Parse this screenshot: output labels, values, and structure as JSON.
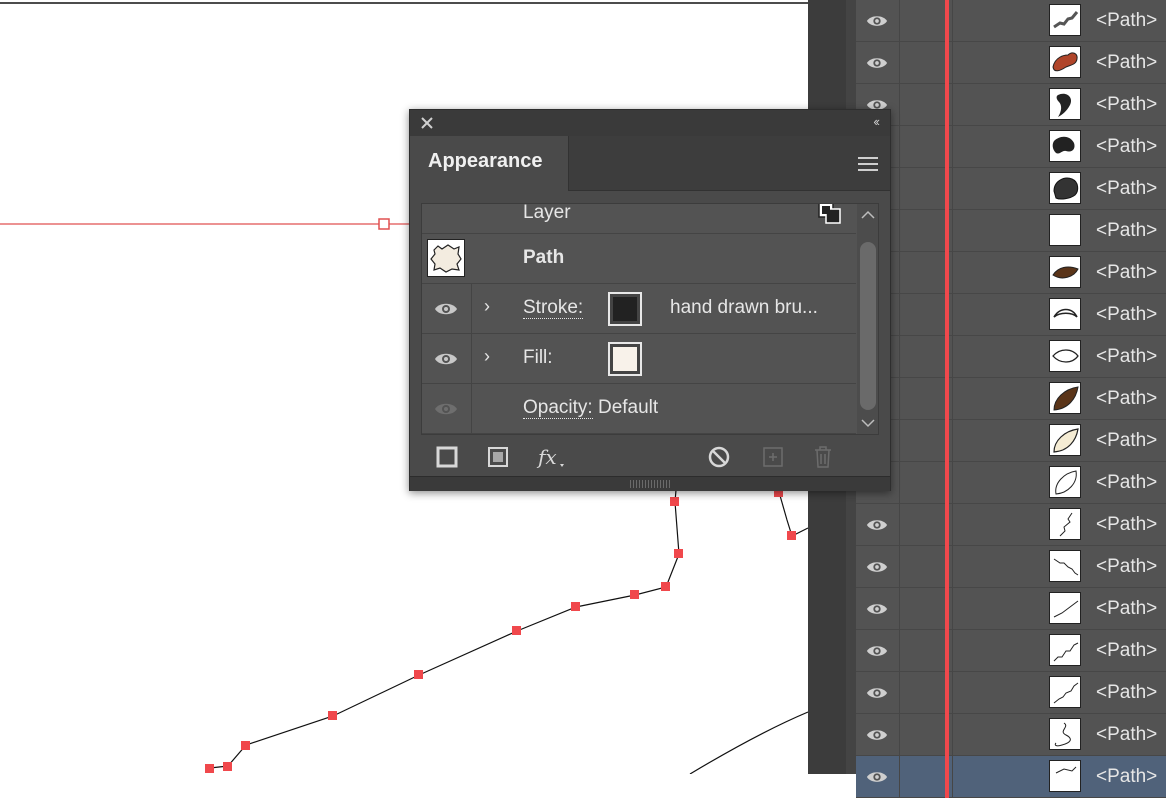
{
  "appearance_panel": {
    "tab_label": "Appearance",
    "layer_label": "Layer",
    "path_label": "Path",
    "stroke_label": "Stroke:",
    "stroke_value": "hand drawn bru...",
    "fill_label": "Fill:",
    "opacity_label": "Opacity:",
    "opacity_value": "Default",
    "stroke_color": "#222222",
    "fill_color": "#f8f2ea",
    "footer_icons": [
      "add-stroke-icon",
      "add-fill-icon",
      "fx-icon",
      "clear-appearance-icon",
      "duplicate-item-icon",
      "delete-item-icon"
    ]
  },
  "layers_panel": {
    "rows": [
      {
        "name": "<Path>",
        "thumb": "brush-stroke"
      },
      {
        "name": "<Path>",
        "thumb": "orange-leaf"
      },
      {
        "name": "<Path>",
        "thumb": "dark-drop"
      },
      {
        "name": "<Path>",
        "thumb": "dark-drop-2"
      },
      {
        "name": "<Path>",
        "thumb": "dark-blob"
      },
      {
        "name": "<Path>",
        "thumb": "blank"
      },
      {
        "name": "<Path>",
        "thumb": "brown-leaf"
      },
      {
        "name": "<Path>",
        "thumb": "outline-arc"
      },
      {
        "name": "<Path>",
        "thumb": "outline-leaf"
      },
      {
        "name": "<Path>",
        "thumb": "brown-teardrop"
      },
      {
        "name": "<Path>",
        "thumb": "cream-teardrop"
      },
      {
        "name": "<Path>",
        "thumb": "thin-leaf"
      },
      {
        "name": "<Path>",
        "thumb": "crack"
      },
      {
        "name": "<Path>",
        "thumb": "scribble"
      },
      {
        "name": "<Path>",
        "thumb": "diagonal-line"
      },
      {
        "name": "<Path>",
        "thumb": "jagged-line"
      },
      {
        "name": "<Path>",
        "thumb": "jagged-line-2"
      },
      {
        "name": "<Path>",
        "thumb": "curl"
      },
      {
        "name": "<Path>",
        "thumb": "selected-sketch",
        "selected": true
      }
    ],
    "accent_color": "#f0484c",
    "selected_color": "#50627a"
  }
}
